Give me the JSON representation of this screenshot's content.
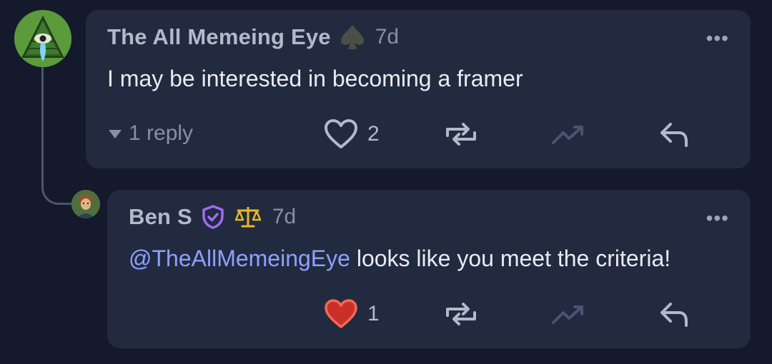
{
  "comments": [
    {
      "author": "The All Memeing Eye",
      "author_badge_icon": "spade-icon",
      "time": "7d",
      "text": "I may be interested in becoming a framer",
      "replies_label": "1 reply",
      "likes": "2",
      "liked": false,
      "more_label": "•••"
    },
    {
      "author": "Ben S",
      "author_badges": [
        "shield-check-icon",
        "scales-icon"
      ],
      "time": "7d",
      "mention": "@TheAllMemeingEye",
      "text": " looks like you meet the criteria!",
      "likes": "1",
      "liked": true,
      "more_label": "•••"
    }
  ],
  "colors": {
    "background": "#141a2b",
    "card": "#222a3f",
    "mention": "#8fa0ff",
    "heart_liked": "#e03a2f",
    "shield_badge": "#a06cf0",
    "scales_badge": "#e8b923"
  }
}
